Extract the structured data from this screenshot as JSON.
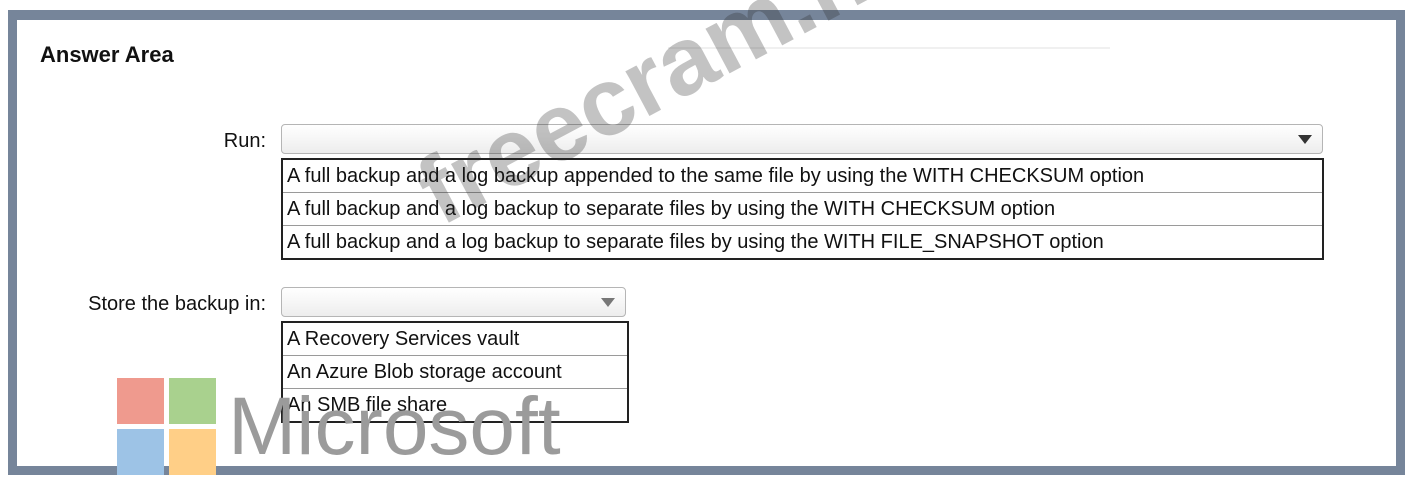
{
  "header": {
    "title": "Answer Area"
  },
  "run": {
    "label": "Run:",
    "selected": "",
    "options": [
      "A full backup and a log backup appended to the same file by using the WITH CHECKSUM option",
      "A full backup and a log backup to separate files by using the WITH CHECKSUM option",
      "A full backup and a log backup to separate files by using the WITH FILE_SNAPSHOT option"
    ]
  },
  "store": {
    "label": "Store the backup in:",
    "selected": "",
    "options": [
      "A Recovery Services vault",
      "An Azure Blob storage account",
      "An SMB file share"
    ]
  },
  "watermark": "freecram.net",
  "brand": {
    "word": "Microsoft",
    "colors": [
      "#ef9a8e",
      "#a9d18e",
      "#9dc3e6",
      "#ffcf87"
    ]
  },
  "icons": {
    "dropdown": "chevron-down-icon"
  }
}
